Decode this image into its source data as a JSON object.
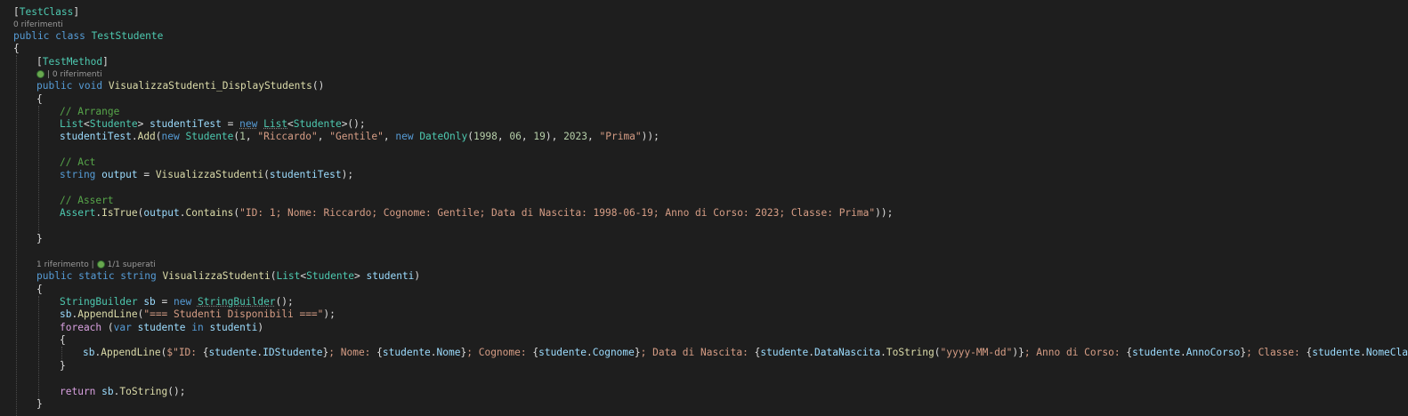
{
  "code_lens": {
    "class_refs": "0 riferimenti",
    "method1_refs": "| 0 riferimenti",
    "method2_refs": "1 riferimento |",
    "method2_tests": "1/1 superati"
  },
  "code": {
    "attr_testclass": "[TestClass]",
    "class_decl_kw": "public class ",
    "class_name": "TestStudente",
    "attr_testmethod": "[TestMethod]",
    "method1_kw": "public void ",
    "method1_name": "VisualizzaStudenti_DisplayStudents",
    "method1_params": "()",
    "comment_arrange": "// Arrange",
    "comment_act": "// Act",
    "comment_assert": "// Assert",
    "assert_string": "\"ID: 1; Nome: Riccardo; Cognome: Gentile; Data di Nascita: 1998-06-19; Anno di Corso: 2023; Classe: Prima\"",
    "method2_kw": "public static string ",
    "method2_name": "VisualizzaStudenti",
    "header_string": "\"=== Studenti Disponibili ===\"",
    "date_format": "\"yyyy-MM-dd\"",
    "return_kw": "return "
  },
  "colors": {
    "background": "#1e1e1e",
    "keyword": "#569cd6",
    "control_keyword": "#d8a0df",
    "type": "#4ec9b0",
    "method": "#dcdcaa",
    "identifier": "#9cdcfe",
    "string": "#d69d85",
    "comment": "#57a64a",
    "lens_dot": "#6aa84f"
  },
  "icons": [
    "test-passed-dot-icon"
  ]
}
